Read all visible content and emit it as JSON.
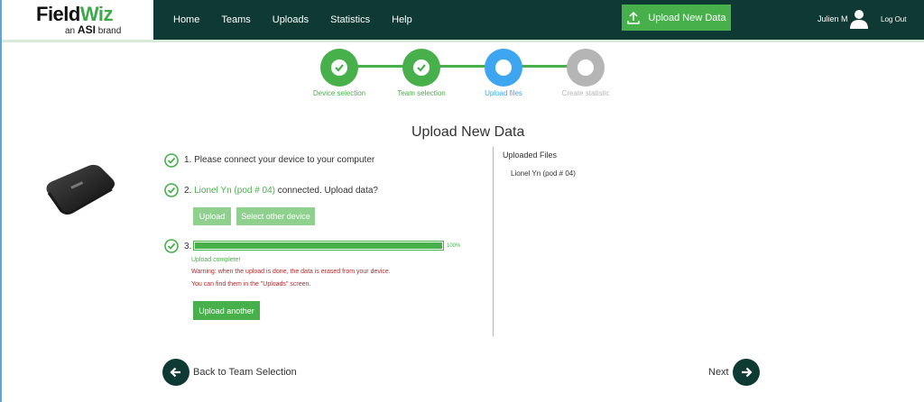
{
  "brand": {
    "name_part1": "Field",
    "name_part2": "Wiz",
    "sub_prefix": "an",
    "sub_asi": "ASI",
    "sub_suffix": "brand"
  },
  "nav": {
    "items": [
      "Home",
      "Teams",
      "Uploads",
      "Statistics",
      "Help"
    ]
  },
  "header": {
    "upload_button": "Upload New Data",
    "user_name": "Julien M",
    "logout": "Log Out"
  },
  "stepper": {
    "steps": [
      {
        "label": "Device selection",
        "state": "done"
      },
      {
        "label": "Team selection",
        "state": "done"
      },
      {
        "label": "Upload files",
        "state": "current"
      },
      {
        "label": "Create statistic",
        "state": "pending"
      }
    ]
  },
  "main": {
    "title": "Upload New Data",
    "step1": "1. Please connect your device to your computer",
    "step2_device": "Lionel Yn (pod # 04)",
    "step2_suffix": " connected. Upload data?",
    "upload_button": "Upload",
    "select_other_button": "Select other device",
    "step3": "3.",
    "progress_percent": 100,
    "progress_label": "100%",
    "upload_complete": "Upload complete!",
    "warning1": "Warning: when the upload is done, the data is erased from your device.",
    "warning2": "You can find them in the \"Uploads\" screen.",
    "upload_another": "Upload another"
  },
  "uploaded_files": {
    "title": "Uploaded Files",
    "items": [
      "Lionel Yn (pod # 04)"
    ]
  },
  "footer": {
    "back": "Back to Team Selection",
    "next": "Next"
  },
  "colors": {
    "accent": "#47b04b",
    "header": "#0f3a33",
    "current": "#3ea5f0",
    "pending": "#b5b5b5",
    "warning": "#b22a2a"
  }
}
